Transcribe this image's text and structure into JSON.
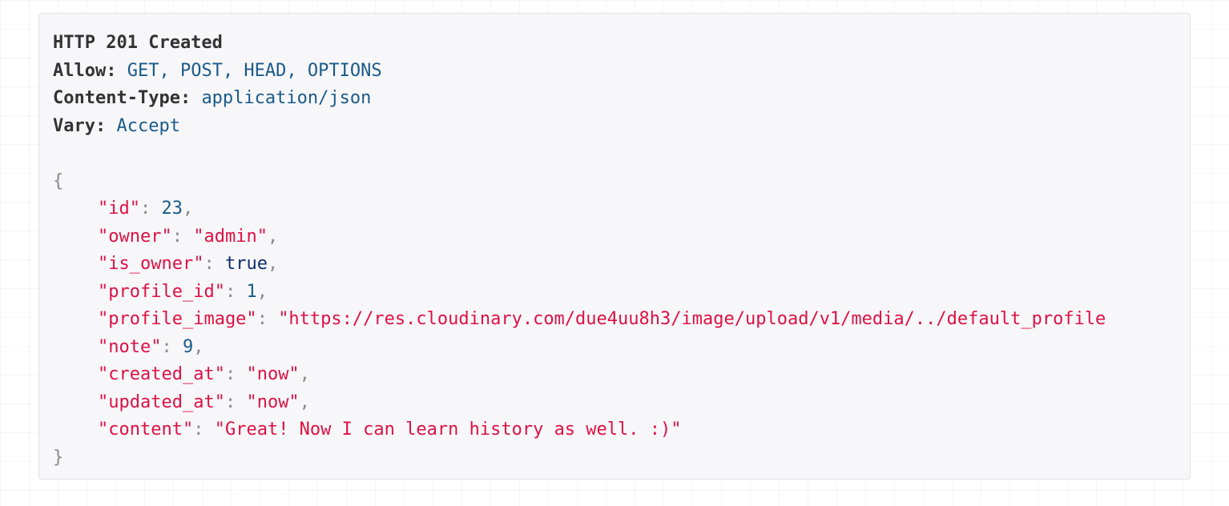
{
  "response": {
    "status": "HTTP 201 Created",
    "headers": [
      {
        "key": "Allow:",
        "value": "GET, POST, HEAD, OPTIONS"
      },
      {
        "key": "Content-Type:",
        "value": "application/json"
      },
      {
        "key": "Vary:",
        "value": "Accept"
      }
    ],
    "body": {
      "open_brace": "{",
      "close_brace": "}",
      "fields": [
        {
          "key": "\"id\"",
          "value": "23",
          "type": "number",
          "comma": ","
        },
        {
          "key": "\"owner\"",
          "value": "\"admin\"",
          "type": "string",
          "comma": ","
        },
        {
          "key": "\"is_owner\"",
          "value": "true",
          "type": "keyword",
          "comma": ","
        },
        {
          "key": "\"profile_id\"",
          "value": "1",
          "type": "number",
          "comma": ","
        },
        {
          "key": "\"profile_image\"",
          "value": "\"https://res.cloudinary.com/due4uu8h3/image/upload/v1/media/../default_profile",
          "type": "string",
          "comma": ""
        },
        {
          "key": "\"note\"",
          "value": "9",
          "type": "number",
          "comma": ","
        },
        {
          "key": "\"created_at\"",
          "value": "\"now\"",
          "type": "string",
          "comma": ","
        },
        {
          "key": "\"updated_at\"",
          "value": "\"now\"",
          "type": "string",
          "comma": ","
        },
        {
          "key": "\"content\"",
          "value": "\"Great! Now I can learn history as well. :)\"",
          "type": "string",
          "comma": ""
        }
      ]
    }
  },
  "colors": {
    "panel_background": "#f7f7f9",
    "panel_border": "#e1e1e8",
    "string": "#dd1144",
    "number": "#1a5a8a",
    "keyword": "#0c2d6b",
    "punctuation": "#8a8a8a",
    "header_value": "#1a5a8a"
  }
}
